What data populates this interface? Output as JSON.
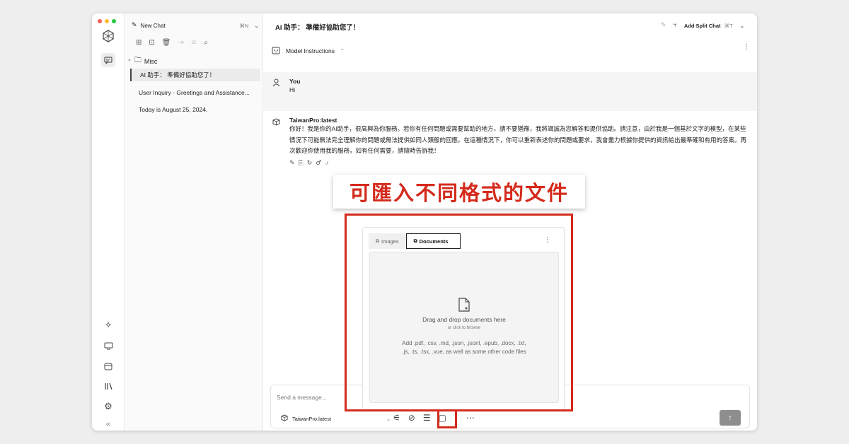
{
  "sidebar": {
    "new_chat": "New Chat",
    "new_chat_shortcut": "⌘N",
    "folder": "Misc",
    "conversations": [
      "AI 助手： 準備好協助您了！",
      "User Inquiry - Greetings and Assistance...",
      "Today is August 25, 2024."
    ]
  },
  "header": {
    "title": "AI 助手： 準備好協助您了！",
    "split_chat": "Add Split Chat",
    "split_shortcut": "⌘T"
  },
  "instructions": {
    "label": "Model Instructions"
  },
  "messages": [
    {
      "author": "You",
      "text": "Hi"
    },
    {
      "author": "TaiwanPro:latest",
      "text": "你好！我是你的AI助手，很高興為你服務。若你有任何問題或需要幫助的地方，請不要猶豫，我將竭誠為您解答和提供協助。請注意，由於我是一個基於文字的模型，在某些情況下可能無法完全理解你的問題或無法提供如同人類般的回應。在這種情況下，你可以重新表述你的問題或要求，我會盡力根據你提供的資訊給出最準確和有用的答案。再次歡迎你使用我的服務，如有任何需要，請隨時告訴我！"
    }
  ],
  "callout": "可匯入不同格式的文件",
  "upload": {
    "tabs": [
      "Images",
      "Documents"
    ],
    "drop_title": "Drag and drop documents here",
    "drop_sub": "or click to browse",
    "formats_line1": "Add .pdf, .csv, .md, .json, .jsonl, .epub, .docx, .txt,",
    "formats_line2": ".js, .ts, .tsx, .vue, as well as some other code files"
  },
  "input": {
    "placeholder": "Send a message...",
    "model": "TaiwanPro:latest"
  },
  "colors": {
    "highlight": "#d42a1c",
    "send_button": "#8e8e8e"
  }
}
